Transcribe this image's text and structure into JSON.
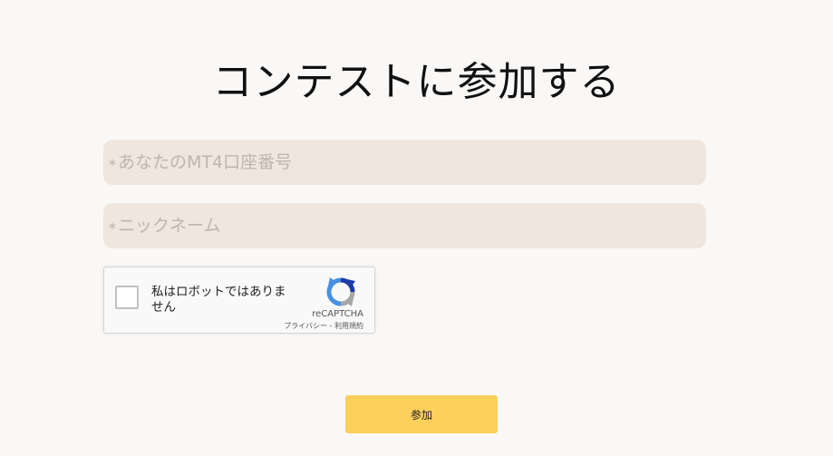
{
  "page": {
    "title": "コンテストに参加する"
  },
  "form": {
    "mt4_field": {
      "required_mark": "*",
      "placeholder": "あなたのMT4口座番号",
      "value": ""
    },
    "nickname_field": {
      "required_mark": "*",
      "placeholder": "ニックネーム",
      "value": ""
    },
    "recaptcha": {
      "label": "私はロボットではありません",
      "brand": "reCAPTCHA",
      "privacy_link": "プライバシー",
      "separator": " - ",
      "terms_link": "利用規約",
      "icon": "recaptcha-logo-icon",
      "checked": false
    },
    "submit_label": "参加"
  },
  "colors": {
    "background": "#faf8f6",
    "field_bg": "#efe7df",
    "button_bg": "#fdd05c"
  }
}
